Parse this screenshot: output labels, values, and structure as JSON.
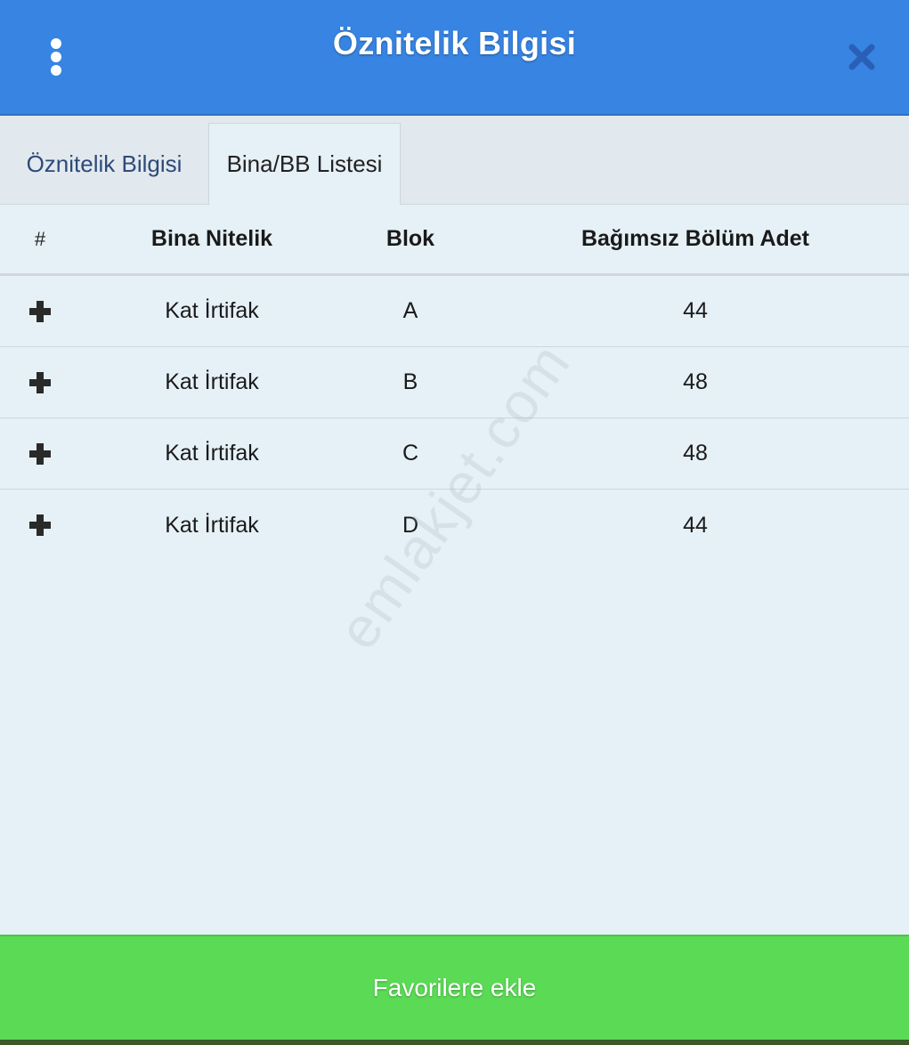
{
  "header": {
    "title": "Öznitelik Bilgisi",
    "menu_icon": "kebab-menu-icon",
    "close_icon": "close-icon",
    "background_color": "#3784e3"
  },
  "tabs": [
    {
      "label": "Öznitelik Bilgisi",
      "active": false
    },
    {
      "label": "Bina/BB Listesi",
      "active": true
    }
  ],
  "table": {
    "columns": [
      "#",
      "Bina Nitelik",
      "Blok",
      "Bağımsız Bölüm Adet"
    ],
    "rows": [
      {
        "expand_icon": "plus-icon",
        "nitelik": "Kat İrtifak",
        "blok": "A",
        "adet": "44"
      },
      {
        "expand_icon": "plus-icon",
        "nitelik": "Kat İrtifak",
        "blok": "B",
        "adet": "48"
      },
      {
        "expand_icon": "plus-icon",
        "nitelik": "Kat İrtifak",
        "blok": "C",
        "adet": "48"
      },
      {
        "expand_icon": "plus-icon",
        "nitelik": "Kat İrtifak",
        "blok": "D",
        "adet": "44"
      }
    ]
  },
  "watermark": "emlakjet.com",
  "footer": {
    "button_label": "Favorilere ekle",
    "background_color": "#5bdb55"
  }
}
